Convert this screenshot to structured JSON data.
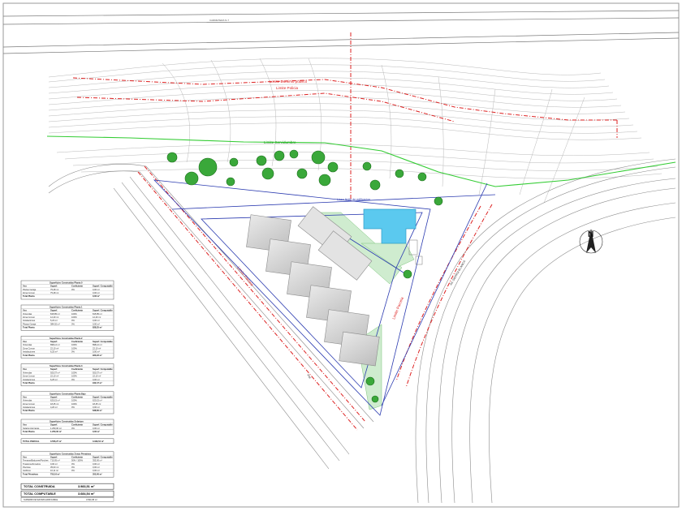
{
  "road_label": "CARRETERA N-7",
  "labels": {
    "dominio_publico": "Limite Dominio publico",
    "policia": "Limite Policia",
    "servidumbre": "Limite Servidumbre",
    "edificacion": "Linea limite de edificacion",
    "parcela_left": "Limite Parcela",
    "parcela_right": "Limite Parcela",
    "calle_curved": "AV. SIERRA BLANCA",
    "calle_left": "Vial"
  },
  "north_label": "N",
  "tables": [
    {
      "title": "Superficies Construidas Planta 0",
      "header": [
        "Uso",
        "Superf.",
        "Coeficiente",
        "Superf. Computable"
      ],
      "rows": [
        [
          "Plazas Garaje",
          "75,28 m²",
          "0%",
          "0,00 m²"
        ],
        [
          "Zona Comun",
          "75,28 m²",
          "",
          "0,00 m²"
        ]
      ],
      "total": [
        "Total Planta",
        "",
        "",
        "0,00 m²"
      ]
    },
    {
      "title": "Superficies Construidas Planta 1",
      "header": [
        "Uso",
        "Superf.",
        "Coeficiente",
        "Superf. Computable"
      ],
      "rows": [
        [
          "Viviendas",
          "815,85 m²",
          "100%",
          "815,85 m²"
        ],
        [
          "Zona Comun",
          "12,40 m²",
          "100%",
          "12,40 m²"
        ],
        [
          "Instalaciones",
          "5,23 m²",
          "0%",
          "0,00 m²"
        ],
        [
          "Plazas Garaje",
          "384,92 m²",
          "0%",
          "0,00 m²"
        ]
      ],
      "total": [
        "Total Planta",
        "",
        "",
        "828,25 m²"
      ]
    },
    {
      "title": "Superficies Construidas Planta 2",
      "header": [
        "Uso",
        "Superf.",
        "Coeficiente",
        "Superf. Computable"
      ],
      "rows": [
        [
          "Viviendas",
          "898,12 m²",
          "100%",
          "898,12 m²"
        ],
        [
          "Zona Comun",
          "22,10 m²",
          "100%",
          "22,10 m²"
        ],
        [
          "Instalaciones",
          "6,25 m²",
          "0%",
          "0,00 m²"
        ]
      ],
      "total": [
        "Total Planta",
        "",
        "",
        "920,22 m²"
      ]
    },
    {
      "title": "Superficies Construidas Planta 3",
      "header": [
        "Uso",
        "Superf.",
        "Coeficiente",
        "Superf. Computable"
      ],
      "rows": [
        [
          "Viviendas",
          "920,37 m²",
          "100%",
          "920,37 m²"
        ],
        [
          "Zona Comun",
          "22,10 m²",
          "100%",
          "22,10 m²"
        ],
        [
          "Instalaciones",
          "6,25 m²",
          "0%",
          "0,00 m²"
        ]
      ],
      "total": [
        "Total Planta",
        "",
        "",
        "942,47 m²"
      ]
    },
    {
      "title": "Superficies Construidas Planta Bajo",
      "header": [
        "Uso",
        "Superf.",
        "Coeficiente",
        "Superf. Computable"
      ],
      "rows": [
        [
          "Viviendas",
          "620,15 m²",
          "100%",
          "620,15 m²"
        ],
        [
          "Zona Comun",
          "18,45 m²",
          "100%",
          "18,45 m²"
        ],
        [
          "Instalaciones",
          "4,20 m²",
          "0%",
          "0,00 m²"
        ]
      ],
      "total": [
        "Total Planta",
        "",
        "",
        "638,60 m²"
      ]
    },
    {
      "title": "Superficies Construidas Solarium",
      "header": [
        "Uso",
        "Superf.",
        "Coeficiente",
        "Superf. Computable"
      ],
      "rows": [
        [
          "Solarium/terrazas",
          "1.250,00 m²",
          "0%",
          "0,00 m²"
        ]
      ],
      "total": [
        "Total Planta",
        "1.250,00 m²",
        "",
        "0,00 m²"
      ]
    }
  ],
  "subtotal": [
    "TOTAL PARCIAL",
    "3.556,27 m²",
    "",
    "3.329,54 m²"
  ],
  "table_zonas": {
    "title": "Superficies Construidas Zonas Privativas",
    "header": [
      "Uso",
      "Superf.",
      "Coeficiente",
      "Superf. Computable"
    ],
    "rows": [
      [
        "Terrazas/Balcones/Porches",
        "710,05 m²",
        "50% / 100%",
        "355,00 m²"
      ],
      [
        "Trasteros/Armarios",
        "0,00 m²",
        "0%",
        "0,00 m²"
      ],
      [
        "Piscinas",
        "35,00 m²",
        "0%",
        "0,00 m²"
      ],
      [
        "Jardines",
        "10,11 m²",
        "0%",
        "0,00 m²"
      ]
    ],
    "total": [
      "Total Privativas",
      "755,16 m²",
      "",
      "355,00 m²"
    ]
  },
  "totals": [
    {
      "label": "TOTAL CONSTRUIDA",
      "value": "3.983,51 m²"
    },
    {
      "label": "TOTAL COMPUTABLE",
      "value": "3.684,54 m²"
    }
  ],
  "total_note": [
    "SUPERFICIE MAXIMA EDIFICABLE",
    "3.694,68 m²"
  ]
}
